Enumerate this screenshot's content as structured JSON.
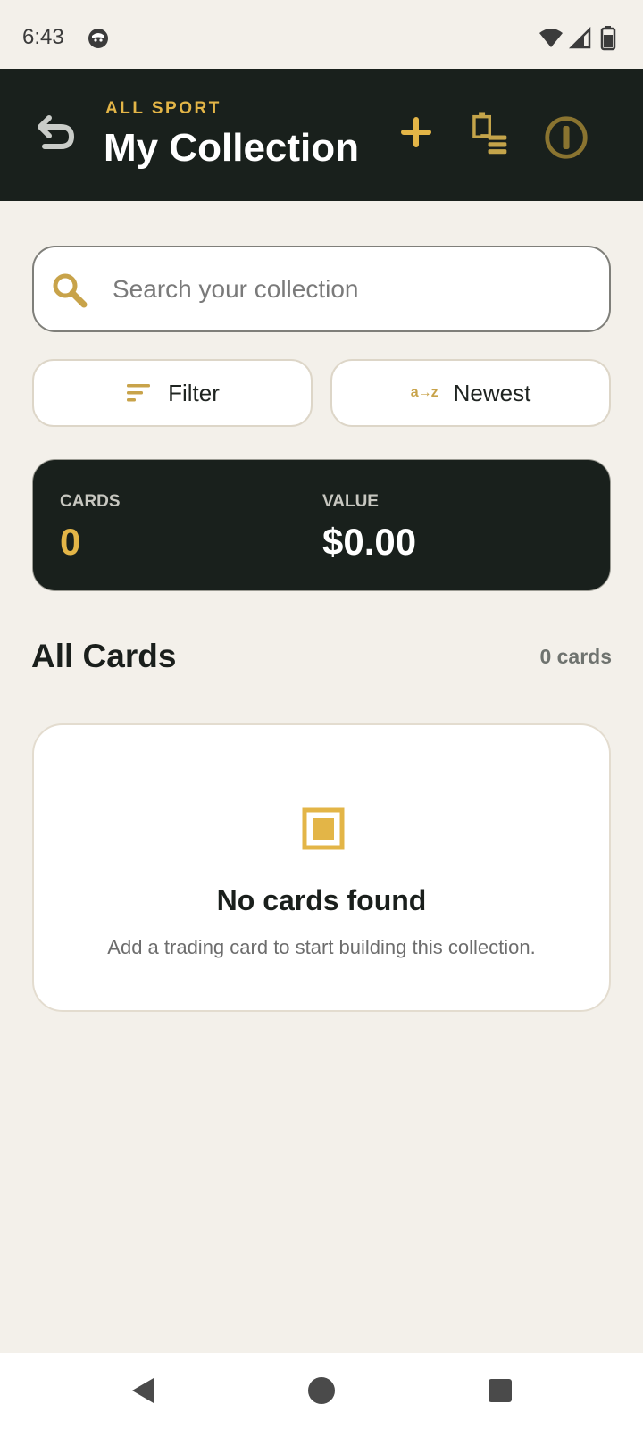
{
  "status_bar": {
    "time": "6:43"
  },
  "header": {
    "overline": "ALL SPORT",
    "title": "My Collection",
    "icons": [
      "undo-icon",
      "plus-icon",
      "list-icon",
      "info-icon"
    ]
  },
  "search": {
    "placeholder": "Search your collection"
  },
  "controls": {
    "filter_label": "Filter",
    "sort_icon_text": "a→z",
    "sort_label": "Newest"
  },
  "stats": {
    "cards_label": "CARDS",
    "cards_value": "0",
    "value_label": "VALUE",
    "value_value": "$0.00"
  },
  "section": {
    "title": "All Cards",
    "count": "0 cards"
  },
  "empty_state": {
    "title": "No cards found",
    "description": "Add a trading card to start building this collection."
  },
  "colors": {
    "accent": "#e3b547",
    "header_bg": "#19201c",
    "page_bg": "#f3f0ea"
  }
}
